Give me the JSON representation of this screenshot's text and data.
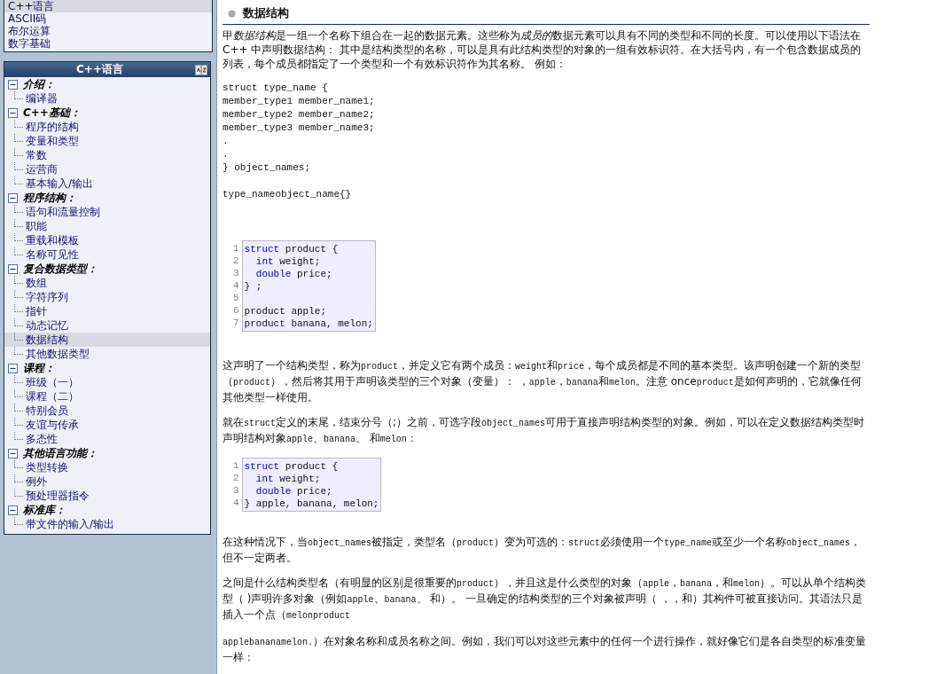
{
  "top_list": {
    "items": [
      {
        "label": "C++语言",
        "selected": true
      },
      {
        "label": "ASCII码",
        "selected": false
      },
      {
        "label": "布尔运算",
        "selected": false
      },
      {
        "label": "数字基础",
        "selected": false
      }
    ]
  },
  "nav": {
    "title": "C++语言",
    "sections": [
      {
        "label": "介绍：",
        "expanded": true,
        "children": [
          {
            "label": "编译器",
            "selected": false
          }
        ]
      },
      {
        "label": "C++基础：",
        "expanded": true,
        "children": [
          {
            "label": "程序的结构",
            "selected": false
          },
          {
            "label": "变量和类型",
            "selected": false
          },
          {
            "label": "常数",
            "selected": false
          },
          {
            "label": "运营商",
            "selected": false
          },
          {
            "label": "基本输入/输出",
            "selected": false
          }
        ]
      },
      {
        "label": "程序结构：",
        "expanded": true,
        "children": [
          {
            "label": "语句和流量控制",
            "selected": false
          },
          {
            "label": "职能",
            "selected": false
          },
          {
            "label": "重载和模板",
            "selected": false
          },
          {
            "label": "名称可见性",
            "selected": false
          }
        ]
      },
      {
        "label": "复合数据类型：",
        "expanded": true,
        "children": [
          {
            "label": "数组",
            "selected": false
          },
          {
            "label": "字符序列",
            "selected": false
          },
          {
            "label": "指针",
            "selected": false
          },
          {
            "label": "动态记忆",
            "selected": false
          },
          {
            "label": "数据结构",
            "selected": true
          },
          {
            "label": "其他数据类型",
            "selected": false
          }
        ]
      },
      {
        "label": "课程：",
        "expanded": true,
        "children": [
          {
            "label": "班级（一）",
            "selected": false
          },
          {
            "label": "课程（二）",
            "selected": false
          },
          {
            "label": "特别会员",
            "selected": false
          },
          {
            "label": "友谊与传承",
            "selected": false
          },
          {
            "label": "多态性",
            "selected": false
          }
        ]
      },
      {
        "label": "其他语言功能：",
        "expanded": true,
        "children": [
          {
            "label": "类型转换",
            "selected": false
          },
          {
            "label": "例外",
            "selected": false
          },
          {
            "label": "预处理器指令",
            "selected": false
          }
        ]
      },
      {
        "label": "标准库：",
        "expanded": true,
        "children": [
          {
            "label": "带文件的输入/输出",
            "selected": false
          }
        ]
      }
    ]
  },
  "article": {
    "title": "数据结构",
    "blocks": [
      {
        "kind": "para",
        "segments": [
          {
            "kind": "text",
            "text": "甲"
          },
          {
            "kind": "em",
            "text": "数据结构"
          },
          {
            "kind": "text",
            "text": "是一组一个名称下组合在一起的数据元素。这些称为"
          },
          {
            "kind": "em",
            "text": "成员的"
          },
          {
            "kind": "text",
            "text": "数据元素可以具有不同的类型和不同的长度。可以使用以下语法在C++ 中声明数据结构： 其中是结构类型的名称，可以是具有此结构类型的对象的一组有效标识符。在大括号内，有一个包含数据成员的列表，每个成员都指定了一个类型和一个有效标识符作为其名称。 例如："
          }
        ]
      },
      {
        "kind": "plain_code",
        "lines": [
          "struct type_name {",
          "member_type1 member_name1;",
          "member_type2 member_name2;",
          "member_type3 member_name3;",
          ".",
          ".",
          "} object_names;"
        ]
      },
      {
        "kind": "plain_code",
        "lines": [
          "type_nameobject_name{}"
        ]
      },
      {
        "kind": "code",
        "lines": [
          {
            "number": "1",
            "segments": [
              {
                "kind": "keyword",
                "text": "struct"
              },
              {
                "kind": "plain",
                "text": " product {"
              }
            ]
          },
          {
            "number": "2",
            "indent": true,
            "segments": [
              {
                "kind": "keyword",
                "text": "int"
              },
              {
                "kind": "plain",
                "text": " weight;"
              }
            ]
          },
          {
            "number": "3",
            "indent": true,
            "segments": [
              {
                "kind": "keyword",
                "text": "double"
              },
              {
                "kind": "plain",
                "text": " price;"
              }
            ]
          },
          {
            "number": "4",
            "segments": [
              {
                "kind": "plain",
                "text": "} ;"
              }
            ]
          },
          {
            "number": "5"
          },
          {
            "number": "6",
            "segments": [
              {
                "kind": "plain",
                "text": "product apple;"
              }
            ]
          },
          {
            "number": "7",
            "segments": [
              {
                "kind": "plain",
                "text": "product banana, melon;"
              }
            ]
          }
        ]
      },
      {
        "kind": "para",
        "segments": [
          {
            "kind": "text",
            "text": "这声明了一个结构类型，称为"
          },
          {
            "kind": "code",
            "text": "product"
          },
          {
            "kind": "text",
            "text": "，并定义它有两个成员："
          },
          {
            "kind": "code",
            "text": "weight"
          },
          {
            "kind": "text",
            "text": "和"
          },
          {
            "kind": "code",
            "text": "price"
          },
          {
            "kind": "text",
            "text": "，每个成员都是不同的基本类型。该声明创建一个新的类型（"
          },
          {
            "kind": "code",
            "text": "product"
          },
          {
            "kind": "text",
            "text": "），然后将其用于声明该类型的三个对象（变量）： ，"
          },
          {
            "kind": "code",
            "text": "apple"
          },
          {
            "kind": "text",
            "text": "，"
          },
          {
            "kind": "code",
            "text": "banana"
          },
          {
            "kind": "text",
            "text": "和"
          },
          {
            "kind": "code",
            "text": "melon"
          },
          {
            "kind": "text",
            "text": "。注意 once"
          },
          {
            "kind": "code",
            "text": "product"
          },
          {
            "kind": "text",
            "text": "是如何声明的，它就像任何其他类型一样使用。"
          }
        ]
      },
      {
        "kind": "para",
        "segments": [
          {
            "kind": "text",
            "text": "就在"
          },
          {
            "kind": "code",
            "text": "struct"
          },
          {
            "kind": "text",
            "text": "定义的末尾，结束分号（;）之前，可选字段"
          },
          {
            "kind": "code",
            "text": "object_names"
          },
          {
            "kind": "text",
            "text": "可用于直接声明结构类型的对象。例如，可以在定义数据结构类型时声明结构对象"
          },
          {
            "kind": "code",
            "text": "apple"
          },
          {
            "kind": "text",
            "text": "、"
          },
          {
            "kind": "code",
            "text": "banana"
          },
          {
            "kind": "text",
            "text": "、 和"
          },
          {
            "kind": "code",
            "text": "melon"
          },
          {
            "kind": "text",
            "text": "："
          }
        ]
      },
      {
        "kind": "code",
        "lines": [
          {
            "number": "1",
            "segments": [
              {
                "kind": "keyword",
                "text": "struct"
              },
              {
                "kind": "plain",
                "text": " product {"
              }
            ]
          },
          {
            "number": "2",
            "indent": true,
            "segments": [
              {
                "kind": "keyword",
                "text": "int"
              },
              {
                "kind": "plain",
                "text": " weight;"
              }
            ]
          },
          {
            "number": "3",
            "indent": true,
            "segments": [
              {
                "kind": "keyword",
                "text": "double"
              },
              {
                "kind": "plain",
                "text": " price;"
              }
            ]
          },
          {
            "number": "4",
            "segments": [
              {
                "kind": "plain",
                "text": "} apple, banana, melon;"
              }
            ]
          }
        ]
      },
      {
        "kind": "para",
        "segments": [
          {
            "kind": "text",
            "text": "在这种情况下，当"
          },
          {
            "kind": "code",
            "text": "object_names"
          },
          {
            "kind": "text",
            "text": "被指定，类型名（"
          },
          {
            "kind": "code",
            "text": "product"
          },
          {
            "kind": "text",
            "text": "）变为可选的："
          },
          {
            "kind": "code",
            "text": "struct"
          },
          {
            "kind": "text",
            "text": "必须使用一个"
          },
          {
            "kind": "code",
            "text": "type_name"
          },
          {
            "kind": "text",
            "text": "或至少一个名称"
          },
          {
            "kind": "code",
            "text": "object_names"
          },
          {
            "kind": "text",
            "text": "，但不一定两者。"
          }
        ]
      },
      {
        "kind": "para",
        "segments": [
          {
            "kind": "text",
            "text": "之间是什么结构类型名（有明显的区别是很重要的"
          },
          {
            "kind": "code",
            "text": "product"
          },
          {
            "kind": "text",
            "text": "），并且这是什么类型的对象（"
          },
          {
            "kind": "code",
            "text": "apple"
          },
          {
            "kind": "text",
            "text": "，"
          },
          {
            "kind": "code",
            "text": "banana"
          },
          {
            "kind": "text",
            "text": "，和"
          },
          {
            "kind": "code",
            "text": "melon"
          },
          {
            "kind": "text",
            "text": "）。可以从单个结构类型（ )声明许多对象（例如"
          },
          {
            "kind": "code",
            "text": "apple"
          },
          {
            "kind": "text",
            "text": "、"
          },
          {
            "kind": "code",
            "text": "banana"
          },
          {
            "kind": "text",
            "text": "、 和）。 一旦确定的结构类型的三个对象被声明（ ，，和）其构件可被直接访问。其语法只是插入一个点（"
          },
          {
            "kind": "code",
            "text": "melonproduct"
          }
        ]
      },
      {
        "kind": "para",
        "segments": [
          {
            "kind": "code",
            "text": "applebananamelon."
          },
          {
            "kind": "text",
            "text": "）在对象名称和成员名称之间。例如，我们可以对这些元素中的任何一个进行操作，就好像它们是各自类型的标准变量一样："
          }
        ]
      }
    ]
  }
}
